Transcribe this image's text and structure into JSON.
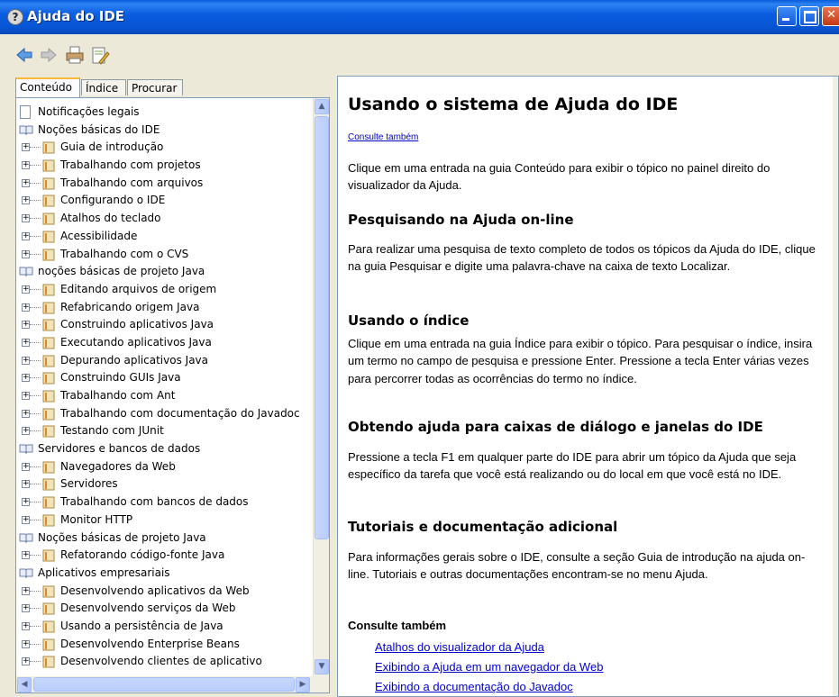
{
  "window": {
    "title": "Ajuda do IDE"
  },
  "tabs": [
    "Conteúdo",
    "Índice",
    "Procurar"
  ],
  "tree": [
    {
      "label": "Notificações legais",
      "type": "doc",
      "child": false
    },
    {
      "label": "Noções básicas do IDE",
      "type": "book",
      "child": false
    },
    {
      "label": "Guia de introdução",
      "type": "node",
      "child": true
    },
    {
      "label": "Trabalhando com projetos",
      "type": "node",
      "child": true
    },
    {
      "label": "Trabalhando com arquivos",
      "type": "node",
      "child": true
    },
    {
      "label": "Configurando o IDE",
      "type": "node",
      "child": true
    },
    {
      "label": "Atalhos do teclado",
      "type": "node",
      "child": true
    },
    {
      "label": "Acessibilidade",
      "type": "node",
      "child": true
    },
    {
      "label": "Trabalhando com o CVS",
      "type": "node",
      "child": true
    },
    {
      "label": "noções básicas de projeto Java",
      "type": "book",
      "child": false
    },
    {
      "label": "Editando arquivos de origem",
      "type": "node",
      "child": true
    },
    {
      "label": "Refabricando origem Java",
      "type": "node",
      "child": true
    },
    {
      "label": "Construindo aplicativos Java",
      "type": "node",
      "child": true
    },
    {
      "label": "Executando aplicativos Java",
      "type": "node",
      "child": true
    },
    {
      "label": "Depurando aplicativos Java",
      "type": "node",
      "child": true
    },
    {
      "label": "Construindo GUIs Java",
      "type": "node",
      "child": true
    },
    {
      "label": "Trabalhando com Ant",
      "type": "node",
      "child": true
    },
    {
      "label": "Trabalhando com documentação do Javadoc",
      "type": "node",
      "child": true
    },
    {
      "label": "Testando com JUnit",
      "type": "node",
      "child": true
    },
    {
      "label": "Servidores e bancos de dados",
      "type": "book",
      "child": false
    },
    {
      "label": "Navegadores da Web",
      "type": "node",
      "child": true
    },
    {
      "label": "Servidores",
      "type": "node",
      "child": true
    },
    {
      "label": "Trabalhando com bancos de dados",
      "type": "node",
      "child": true
    },
    {
      "label": "Monitor HTTP",
      "type": "node",
      "child": true
    },
    {
      "label": "Noções básicas de projeto Java",
      "type": "book",
      "child": false
    },
    {
      "label": "Refatorando código-fonte Java",
      "type": "node",
      "child": true
    },
    {
      "label": "Aplicativos empresariais",
      "type": "book",
      "child": false
    },
    {
      "label": "Desenvolvendo aplicativos da Web",
      "type": "node",
      "child": true
    },
    {
      "label": "Desenvolvendo serviços da Web",
      "type": "node",
      "child": true
    },
    {
      "label": "Usando a persistência de Java",
      "type": "node",
      "child": true
    },
    {
      "label": "Desenvolvendo Enterprise Beans",
      "type": "node",
      "child": true
    },
    {
      "label": "Desenvolvendo clientes de aplicativo",
      "type": "node",
      "child": true
    }
  ],
  "content": {
    "title": "Usando o sistema de Ajuda do IDE",
    "see_also_link": "Consulte também",
    "intro": "Clique em uma entrada na guia Conteúdo para exibir o tópico no painel direito do visualizador da Ajuda.",
    "sections": [
      {
        "heading": "Pesquisando na Ajuda on-line",
        "text": "Para realizar uma pesquisa de texto completo de todos os tópicos da Ajuda do IDE, clique na guia Pesquisar e digite uma palavra-chave na caixa de texto Localizar."
      },
      {
        "heading": "Usando o índice",
        "text": "Clique em uma entrada na guia Índice para exibir o tópico. Para pesquisar o índice, insira um termo no campo de pesquisa e pressione Enter. Pressione a tecla Enter várias vezes para percorrer todas as ocorrências do termo no índice."
      },
      {
        "heading": "Obtendo ajuda para caixas de diálogo e janelas do IDE",
        "text": "Pressione a tecla F1 em qualquer parte do IDE para abrir um tópico da Ajuda que seja específico da tarefa que você está realizando ou do local em que você está no IDE."
      },
      {
        "heading": "Tutoriais e documentação adicional",
        "text": "Para informações gerais sobre o IDE, consulte a seção Guia de introdução na ajuda on-line. Tutoriais e outras documentações encontram-se no menu Ajuda."
      }
    ],
    "see_also_heading": "Consulte também",
    "links": [
      "Atalhos do visualizador da Ajuda",
      "Exibindo a Ajuda em um navegador da Web",
      "Exibindo a documentação do Javadoc"
    ]
  }
}
